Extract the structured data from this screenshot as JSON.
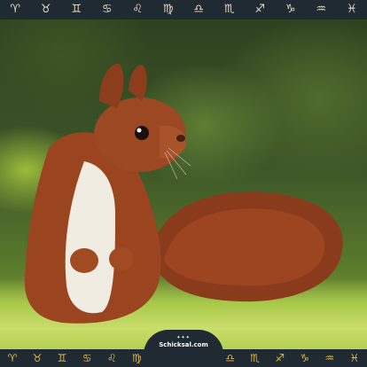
{
  "top_nav": {
    "zodiac_signs": [
      "♈",
      "♉",
      "♊",
      "♋",
      "♌",
      "♍",
      "♎",
      "♏",
      "♐",
      "♑",
      "♒",
      "♓"
    ],
    "icon_names": [
      "aries-icon",
      "taurus-icon",
      "gemini-icon",
      "cancer-icon",
      "leo-icon",
      "virgo-icon",
      "libra-icon",
      "scorpio-icon",
      "sagittarius-icon",
      "capricorn-icon",
      "aquarius-icon",
      "pisces-icon"
    ]
  },
  "photo": {
    "subject": "red squirrel"
  },
  "logo": {
    "text": "Schicksal.com"
  },
  "bottom_nav": {
    "left_icons": [
      "♈",
      "♉",
      "♊",
      "♋",
      "♌",
      "♍"
    ],
    "right_icons": [
      "♎",
      "♏",
      "♐",
      "♑",
      "♒",
      "♓"
    ],
    "icon_color": "#e2b84a"
  },
  "colors": {
    "bar_background": "#1f2a32",
    "zodiac_glyph": "#e8dcc0"
  }
}
